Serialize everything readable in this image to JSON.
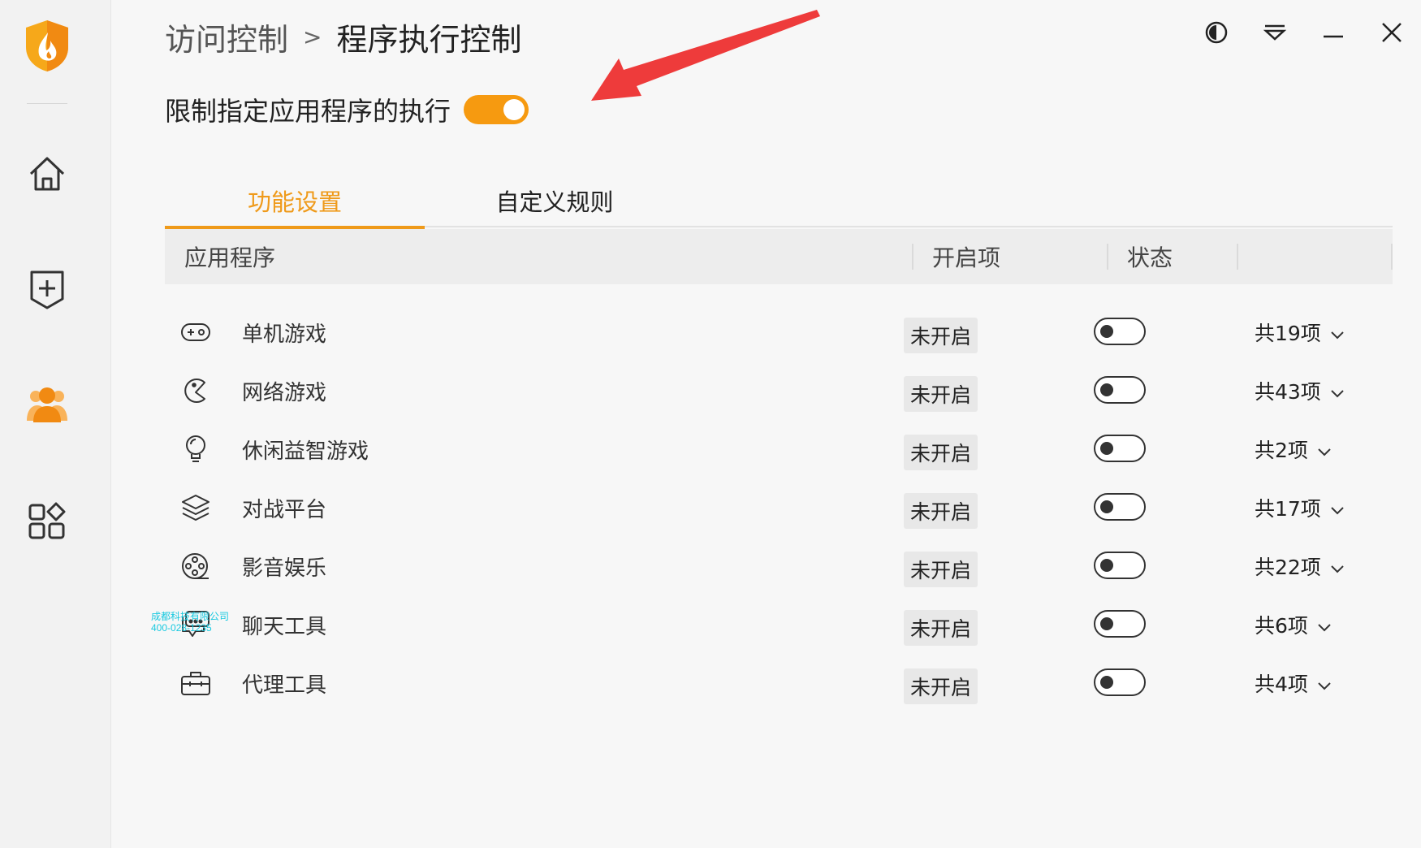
{
  "breadcrumb": {
    "parent": "访问控制",
    "separator": ">",
    "current": "程序执行控制"
  },
  "window_controls": [
    "theme-icon",
    "collapse-icon",
    "minimize-icon",
    "close-icon"
  ],
  "master": {
    "label": "限制指定应用程序的执行",
    "enabled": true
  },
  "tabs": [
    {
      "label": "功能设置",
      "active": true
    },
    {
      "label": "自定义规则",
      "active": false
    }
  ],
  "table": {
    "headers": {
      "app": "应用程序",
      "startup": "开启项",
      "status": "状态"
    },
    "rows": [
      {
        "icon": "gamepad-icon",
        "name": "单机游戏",
        "startup": "未开启",
        "enabled": false,
        "count": "共19项"
      },
      {
        "icon": "pacman-icon",
        "name": "网络游戏",
        "startup": "未开启",
        "enabled": false,
        "count": "共43项"
      },
      {
        "icon": "lightbulb-icon",
        "name": "休闲益智游戏",
        "startup": "未开启",
        "enabled": false,
        "count": "共2项"
      },
      {
        "icon": "layers-icon",
        "name": "对战平台",
        "startup": "未开启",
        "enabled": false,
        "count": "共17项"
      },
      {
        "icon": "film-reel-icon",
        "name": "影音娱乐",
        "startup": "未开启",
        "enabled": false,
        "count": "共22项"
      },
      {
        "icon": "chat-bubble-icon",
        "name": "聊天工具",
        "startup": "未开启",
        "enabled": false,
        "count": "共6项"
      },
      {
        "icon": "toolbox-icon",
        "name": "代理工具",
        "startup": "未开启",
        "enabled": false,
        "count": "共4项"
      }
    ]
  },
  "sidebar": [
    "home-icon",
    "shield-plus-icon",
    "users-icon",
    "apps-icon"
  ],
  "watermark": {
    "line1": "成都科技有限公司",
    "line2": "400-028-1235"
  },
  "colors": {
    "accent": "#f69a10",
    "annotation_arrow": "#ee3b3b"
  }
}
